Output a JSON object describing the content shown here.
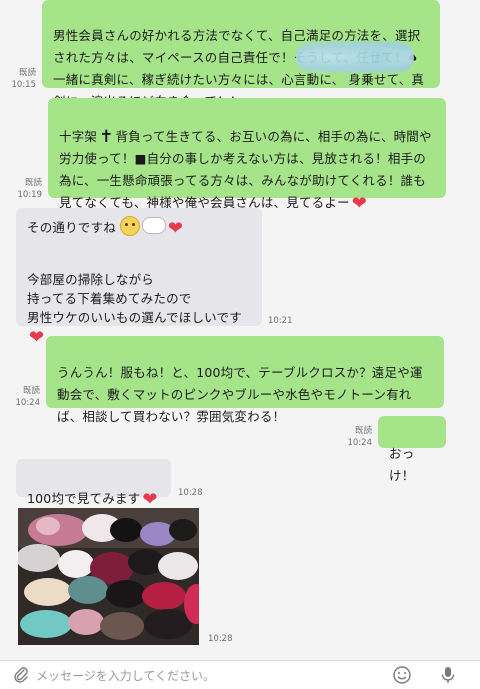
{
  "messages": [
    {
      "id": "m1",
      "direction": "sent",
      "text": "男性会員さんの好かれる方法でなくて、自己満足の方法を、選択された方々は、マイペースの自己責任で！そうして、任せて！♠一緒に真剣に、稼ぎ続けたい方々には、心言動に、 身乗せて、真剣に、涙出るほど向き合って！！",
      "read_label": "既読",
      "time": "10:15"
    },
    {
      "id": "m2",
      "direction": "sent",
      "text_before_cross": "十字架",
      "text_after_cross": "背負って生きてる、お互いの為に、相手の為に、時間や労力使って！■自分の事しか考えない方は、見放される！相手の為に、一生懸命頑張ってる方々は、みんなが助けてくれる！誰も見てなくても、神様や俺や会員さんは、見てるよー",
      "read_label": "既読",
      "time": "10:19"
    },
    {
      "id": "m3",
      "direction": "received",
      "line1": "その通りですね",
      "line2": "今部屋の掃除しながら\n持ってる下着集めてみたので\n男性ウケのいいもの選んでほしいです",
      "time": "10:21"
    },
    {
      "id": "m4",
      "direction": "sent",
      "text": "うんうん！服もね！と、100均で、テーブルクロスか？遠足や運動会で、敷くマットのピンクやブルーや水色やモノトーン有れば、相談して買わない？雰囲気変わる！",
      "read_label": "既読",
      "time": "10:24"
    },
    {
      "id": "m5",
      "direction": "sent",
      "text": "おっけ！",
      "read_label": "既読",
      "time": "10:24"
    },
    {
      "id": "m6",
      "direction": "received",
      "text": "100均で見てみます",
      "time": "10:28"
    },
    {
      "id": "m7",
      "direction": "received",
      "type": "photo",
      "time": "10:28"
    }
  ],
  "icons": {
    "heart": "❤",
    "cross": "✝",
    "attachment": "paperclip-icon",
    "emoji": "smiley-icon",
    "voice": "microphone-icon"
  },
  "input": {
    "placeholder": "メッセージを入力してください。"
  },
  "colors": {
    "sent_bubble": "#a6e48a",
    "received_bubble": "#e6e6ea",
    "background": "#f4f4f4",
    "heart": "#e8394d"
  }
}
